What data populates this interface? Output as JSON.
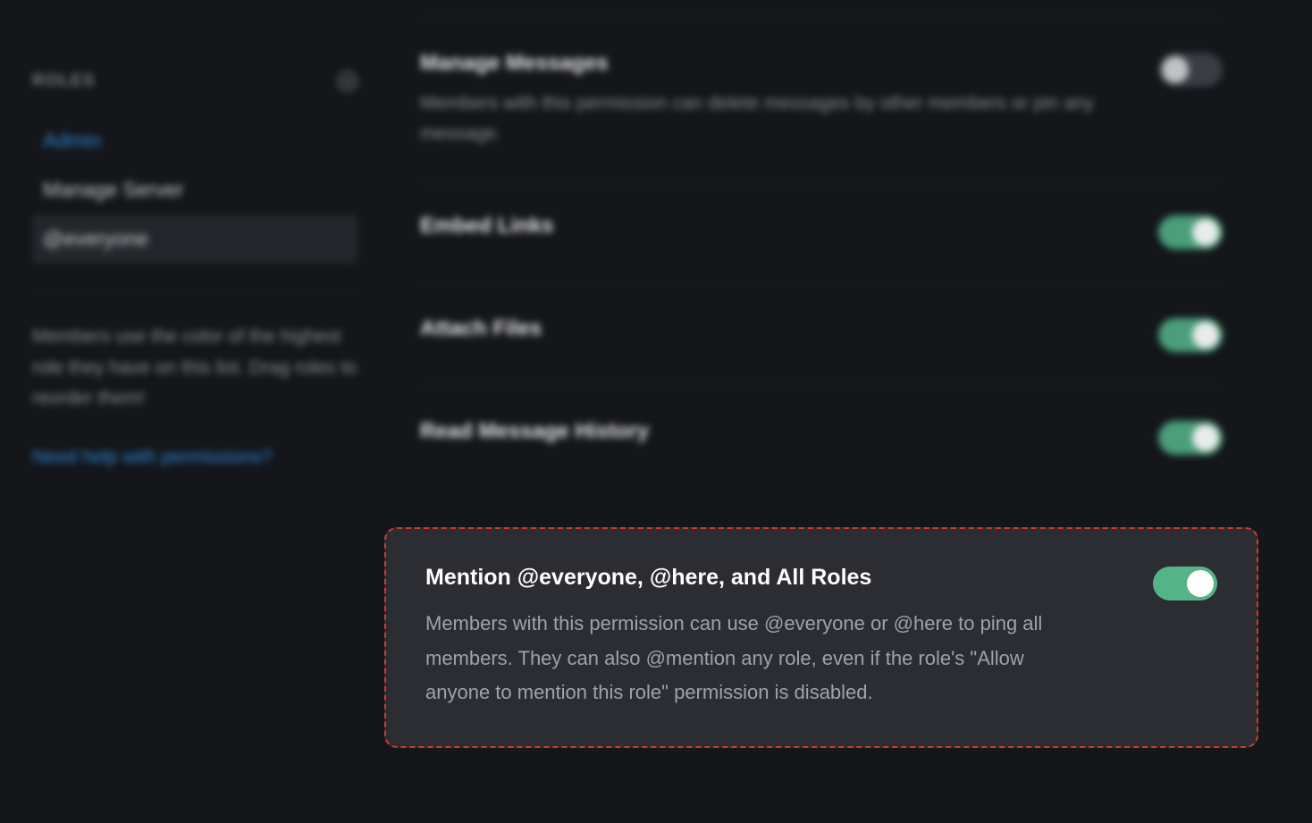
{
  "sidebar": {
    "title": "ROLES",
    "roles": [
      {
        "label": "Admin"
      },
      {
        "label": "Manage Server"
      },
      {
        "label": "@everyone"
      }
    ],
    "hint": "Members use the color of the highest role they have on this list. Drag roles to reorder them!",
    "help_link": "Need help with permissions?"
  },
  "permissions": {
    "manage_messages": {
      "title": "Manage Messages",
      "desc": "Members with this permission can delete messages by other members or pin any message.",
      "enabled": false
    },
    "embed_links": {
      "title": "Embed Links",
      "desc": "",
      "enabled": true
    },
    "attach_files": {
      "title": "Attach Files",
      "desc": "",
      "enabled": true
    },
    "read_history": {
      "title": "Read Message History",
      "desc": "",
      "enabled": true
    },
    "mention_everyone": {
      "title": "Mention @everyone, @here, and All Roles",
      "desc": "Members with this permission can use @everyone or @here to ping all members. They can also @mention any role, even if the role's \"Allow anyone to mention this role\" permission is disabled.",
      "enabled": true
    }
  }
}
